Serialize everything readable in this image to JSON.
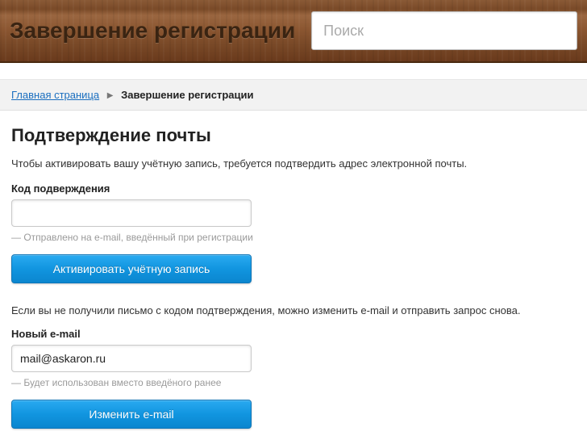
{
  "header": {
    "title": "Завершение регистрации",
    "search_placeholder": "Поиск"
  },
  "breadcrumb": {
    "home": "Главная страница",
    "current": "Завершение регистрации"
  },
  "main": {
    "heading": "Подтверждение почты",
    "intro": "Чтобы активировать вашу учётную запись, требуется подтвердить адрес электронной почты.",
    "code": {
      "label": "Код подверждения",
      "hint": "— Отправлено на e-mail, введённый при регистрации",
      "button": "Активировать учётную запись"
    },
    "resend_text": "Если вы не получили письмо с кодом подтверждения, можно изменить e-mail и отправить запрос снова.",
    "email": {
      "label": "Новый e-mail",
      "value": "mail@askaron.ru",
      "hint": "— Будет использован вместо введёного ранее",
      "button": "Изменить e-mail"
    }
  }
}
